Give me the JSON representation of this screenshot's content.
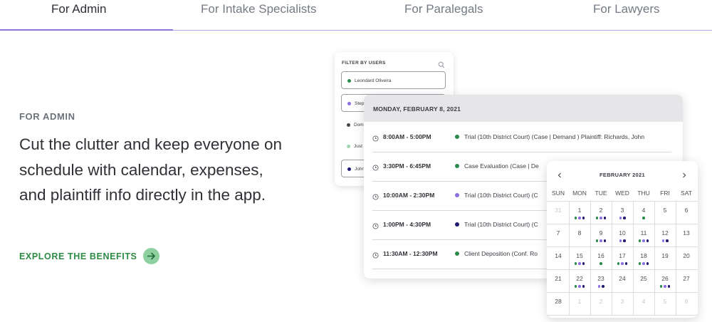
{
  "tabs": [
    {
      "label": "For Admin",
      "active": true
    },
    {
      "label": "For Intake Specialists",
      "active": false
    },
    {
      "label": "For Paralegals",
      "active": false
    },
    {
      "label": "For Lawyers",
      "active": false
    }
  ],
  "hero": {
    "eyebrow": "FOR ADMIN",
    "headline": "Cut the clutter and keep everyone on schedule with calendar, expenses, and plaintiff info directly in the app.",
    "cta_label": "EXPLORE THE BENEFITS",
    "cta_icon": "arrow-right-icon"
  },
  "colors": {
    "accent_purple": "#8f76d8",
    "cta_green": "#2d8a45",
    "cta_icon_bg": "#8fd0a1",
    "dot_green": "#2a8a4a",
    "dot_purple": "#8a70e0",
    "dot_navy": "#1f1a6e",
    "dot_dark": "#444444",
    "dot_light_green": "#9fd6ad"
  },
  "filter": {
    "title": "FILTER BY USERS",
    "search_icon": "search-icon",
    "users": [
      {
        "name": "Leondard Oliveira",
        "color": "#2a8a4a",
        "boxed": true
      },
      {
        "name": "Step",
        "color": "#8a70e0",
        "boxed": true
      },
      {
        "name": "Dom",
        "color": "#444444",
        "boxed": false
      },
      {
        "name": "Just",
        "color": "#9fd6ad",
        "boxed": false
      },
      {
        "name": "John",
        "color": "#1f1a6e",
        "boxed": true
      }
    ]
  },
  "schedule": {
    "date": "MONDAY, FEBRUARY 8, 2021",
    "events": [
      {
        "time": "8:00AM - 5:00PM",
        "title": "Trial (10th District Court) (Case | Demand ) Plaintiff: Richards, John",
        "color": "#2a8a4a"
      },
      {
        "time": "3:30PM - 6:45PM",
        "title": "Case Evaluation (Case | De",
        "color": "#2a8a4a"
      },
      {
        "time": "10:00AM - 2:30PM",
        "title": "Trial (10th District Court) (C",
        "color": "#8a70e0"
      },
      {
        "time": "1:00PM - 4:30PM",
        "title": "Trial (10th District Court) (C",
        "color": "#1f1a6e"
      },
      {
        "time": "11:30AM - 12:30PM",
        "title": "Client Deposition (Conf. Ro",
        "color": "#2a8a4a"
      }
    ]
  },
  "calendar": {
    "month": "FEBRUARY 2021",
    "weekdays": [
      "SUN",
      "MON",
      "TUE",
      "WED",
      "THU",
      "FRI",
      "SAT"
    ],
    "weeks": [
      [
        {
          "day": "31",
          "muted": true,
          "dots": []
        },
        {
          "day": "1",
          "muted": false,
          "dots": [
            "#2a8a4a",
            "#8a70e0",
            "#1f1a6e"
          ]
        },
        {
          "day": "2",
          "muted": false,
          "dots": [
            "#2a8a4a",
            "#8a70e0",
            "#1f1a6e"
          ]
        },
        {
          "day": "3",
          "muted": false,
          "dots": [
            "#8a70e0",
            "#1f1a6e"
          ]
        },
        {
          "day": "4",
          "muted": false,
          "dots": [
            "#2a8a4a"
          ]
        },
        {
          "day": "5",
          "muted": false,
          "dots": []
        },
        {
          "day": "6",
          "muted": false,
          "dots": []
        }
      ],
      [
        {
          "day": "7",
          "muted": false,
          "dots": []
        },
        {
          "day": "8",
          "muted": false,
          "dots": []
        },
        {
          "day": "9",
          "muted": false,
          "dots": [
            "#2a8a4a",
            "#8a70e0",
            "#1f1a6e"
          ]
        },
        {
          "day": "10",
          "muted": false,
          "dots": [
            "#8a70e0",
            "#1f1a6e"
          ]
        },
        {
          "day": "11",
          "muted": false,
          "dots": [
            "#2a8a4a",
            "#8a70e0",
            "#1f1a6e"
          ]
        },
        {
          "day": "12",
          "muted": false,
          "dots": [
            "#8a70e0",
            "#1f1a6e"
          ]
        },
        {
          "day": "13",
          "muted": false,
          "dots": []
        }
      ],
      [
        {
          "day": "14",
          "muted": false,
          "dots": []
        },
        {
          "day": "15",
          "muted": false,
          "dots": [
            "#2a8a4a",
            "#8a70e0",
            "#1f1a6e"
          ]
        },
        {
          "day": "16",
          "muted": false,
          "dots": [
            "#2a8a4a"
          ]
        },
        {
          "day": "17",
          "muted": false,
          "dots": [
            "#2a8a4a",
            "#8a70e0",
            "#1f1a6e"
          ]
        },
        {
          "day": "18",
          "muted": false,
          "dots": [
            "#2a8a4a",
            "#8a70e0",
            "#1f1a6e"
          ]
        },
        {
          "day": "19",
          "muted": false,
          "dots": []
        },
        {
          "day": "20",
          "muted": false,
          "dots": []
        }
      ],
      [
        {
          "day": "21",
          "muted": false,
          "dots": []
        },
        {
          "day": "22",
          "muted": false,
          "dots": [
            "#2a8a4a",
            "#8a70e0",
            "#1f1a6e"
          ]
        },
        {
          "day": "23",
          "muted": false,
          "dots": [
            "#8a70e0",
            "#1f1a6e"
          ]
        },
        {
          "day": "24",
          "muted": false,
          "dots": []
        },
        {
          "day": "25",
          "muted": false,
          "dots": []
        },
        {
          "day": "26",
          "muted": false,
          "dots": [
            "#2a8a4a",
            "#8a70e0",
            "#1f1a6e"
          ]
        },
        {
          "day": "27",
          "muted": false,
          "dots": []
        }
      ],
      [
        {
          "day": "28",
          "muted": false,
          "dots": []
        },
        {
          "day": "1",
          "muted": true,
          "dots": []
        },
        {
          "day": "2",
          "muted": true,
          "dots": []
        },
        {
          "day": "3",
          "muted": true,
          "dots": []
        },
        {
          "day": "4",
          "muted": true,
          "dots": []
        },
        {
          "day": "5",
          "muted": true,
          "dots": []
        },
        {
          "day": "6",
          "muted": true,
          "dots": []
        }
      ]
    ]
  }
}
